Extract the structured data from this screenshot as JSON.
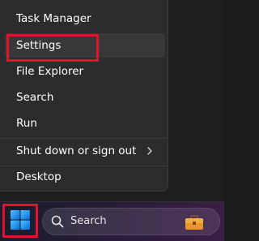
{
  "menu": {
    "items": [
      {
        "label": "Task Manager"
      },
      {
        "label": "Settings"
      },
      {
        "label": "File Explorer"
      },
      {
        "label": "Search"
      },
      {
        "label": "Run"
      },
      {
        "label": "Shut down or sign out",
        "has_submenu": true
      },
      {
        "label": "Desktop"
      }
    ],
    "hovered_item": "Settings",
    "submenu_icon": "chevron-right-icon"
  },
  "annotations": {
    "highlight_color": "#e0152b",
    "highlighted": [
      "Settings",
      "Start"
    ]
  },
  "taskbar": {
    "start_icon": "windows-logo-icon",
    "search": {
      "label": "Search",
      "icon": "search-icon",
      "widget_icon": "briefcase-icon"
    }
  },
  "colors": {
    "menu_background": "#2c2c2c",
    "menu_hover": "#383838",
    "windows_logo": "#1e90ff"
  }
}
